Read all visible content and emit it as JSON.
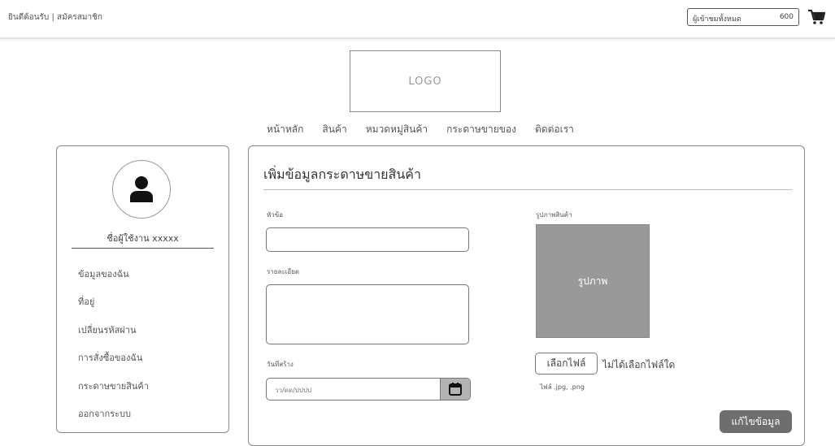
{
  "top": {
    "login": "ยินดีต้อนรับ",
    "separator": "|",
    "register": "สมัครสมาชิก",
    "visitors_label": "ผู้เข้าชมทั้งหมด",
    "visitors_count": "600",
    "cart_icon": "cart-icon"
  },
  "logo": "LOGO",
  "nav": [
    "หน้าหลัก",
    "สินค้า",
    "หมวดหมู่สินค้า",
    "กระดาษขายของ",
    "ติดต่อเรา"
  ],
  "sidebar": {
    "avatar_icon": "user-icon",
    "username": "ชื่อผู้ใช้งาน xxxxx",
    "items": [
      "ข้อมูลของฉัน",
      "ที่อยู่",
      "เปลี่ยนรหัสผ่าน",
      "การสั่งซื้อของฉัน",
      "กระดาษขายสินค้า",
      "ออกจากระบบ"
    ]
  },
  "form": {
    "title": "เพิ่มข้อมูลกระดาษขายสินค้า",
    "topic_label": "หัวข้อ",
    "topic_value": "",
    "detail_label": "รายละเอียด",
    "detail_value": "",
    "date_label": "วันที่สร้าง",
    "date_placeholder": "วว/ดด/ปปปป",
    "image_label": "รูปภาพสินค้า",
    "image_placeholder": "รูปภาพ",
    "file_button": "เลือกไฟล์",
    "file_status": "ไม่ได้เลือกไฟล์ใด",
    "file_hint": "ไฟล์ .jpg, .png",
    "save_button": "แก้ไขข้อมูล"
  },
  "colors": {
    "button_bg": "#6e6e6e",
    "image_bg": "#999999",
    "calendar_btn": "#b3b3b3"
  }
}
